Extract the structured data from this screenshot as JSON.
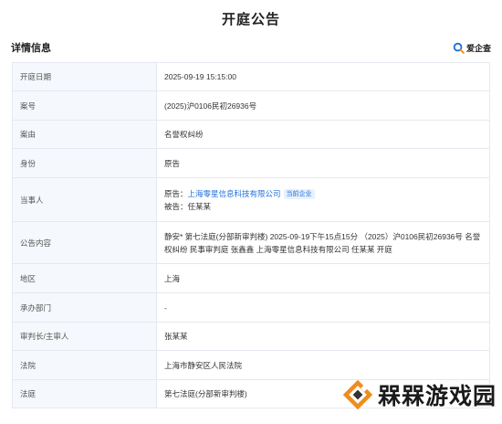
{
  "page": {
    "title": "开庭公告"
  },
  "section": {
    "title": "详情信息"
  },
  "brand": {
    "name": "爱企查",
    "icon": "search-magnifier-icon"
  },
  "fields": {
    "hearing_date": {
      "label": "开庭日期",
      "value": "2025-09-19 15:15:00"
    },
    "case_no": {
      "label": "案号",
      "value": "(2025)沪0106民初26936号"
    },
    "cause": {
      "label": "案由",
      "value": "名誉权纠纷"
    },
    "role": {
      "label": "身份",
      "value": "原告"
    },
    "parties": {
      "label": "当事人",
      "plaintiff_prefix": "原告：",
      "plaintiff_name": "上海零星信息科技有限公司",
      "current_tag": "当前企业",
      "defendant_prefix": "被告：",
      "defendant_name": "任某某"
    },
    "content": {
      "label": "公告内容",
      "value": "静安* 第七法庭(分部新审判楼) 2025-09-19下午15点15分 （2025）沪0106民初26936号 名誉权纠纷 民事审判庭 张鑫鑫 上海零星信息科技有限公司 任某某 开庭"
    },
    "region": {
      "label": "地区",
      "value": "上海"
    },
    "department": {
      "label": "承办部门",
      "value": "-"
    },
    "judge": {
      "label": "审判长/主审人",
      "value": "张某某"
    },
    "court": {
      "label": "法院",
      "value": "上海市静安区人民法院"
    },
    "courtroom": {
      "label": "法庭",
      "value": "第七法庭(分部新审判楼)"
    }
  },
  "watermark": {
    "text": "槑槑游戏园",
    "icon": "diamond-logo-icon"
  },
  "colors": {
    "link": "#1e6fd9",
    "label_bg": "#f5f8fc",
    "border": "#e5e9f0",
    "watermark_orange": "#f08c1e"
  }
}
